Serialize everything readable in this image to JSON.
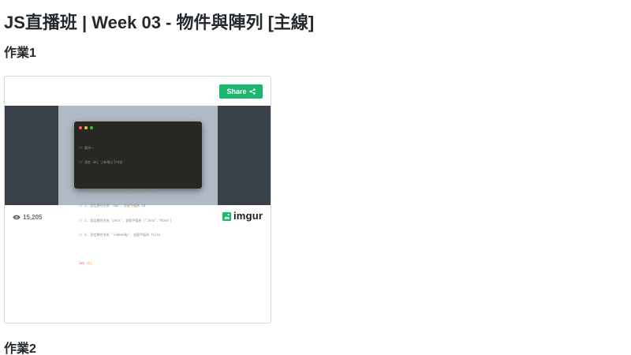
{
  "page": {
    "title": "JS直播班 | Week 03 - 物件與陣列 [主線]",
    "sections": [
      {
        "heading": "作業1"
      },
      {
        "heading": "作業2"
      }
    ]
  },
  "embed": {
    "share_label": "Share",
    "view_count": "15,205",
    "brand": "imgur",
    "share_color": "#1bb76e",
    "code_lines": [
      "// 範例一",
      "// 請在 obj 上新增以下內容",
      "",
      "// 1. 設定屬性名為 \"myName\"，並賦予值為 \"Tom\"",
      "// 2. 設定屬性名為 \"age\"，並賦予值為 18",
      "// 3. 設定屬性名為 \"pets\"，並賦予值為 [\"John\",\"Mike\"]",
      "// 4. 設定屬性名為 \"isWeekDp\"，並賦予值為 false",
      ""
    ],
    "code_last": {
      "keyword": "let",
      "name": "obj",
      "rest": " = {}"
    },
    "icons": {
      "share": "share-icon",
      "views": "eye-icon",
      "brand": "imgur-logo-icon"
    }
  }
}
